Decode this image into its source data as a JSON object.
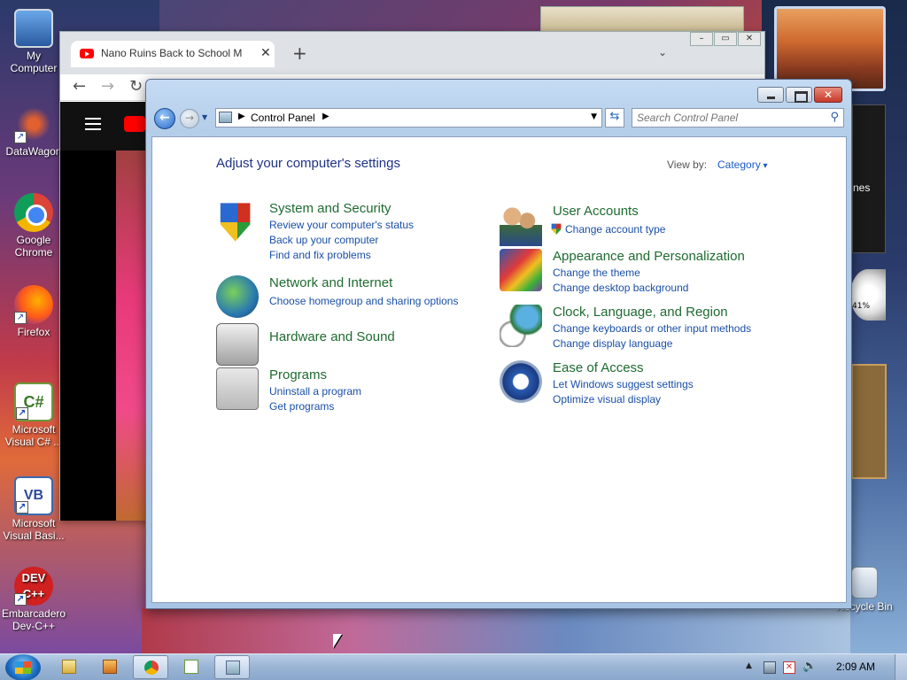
{
  "desktop": {
    "icons": [
      {
        "label": "My Computer",
        "icon": "computer-icon"
      },
      {
        "label": "DataWagon",
        "icon": "datawagon-icon"
      },
      {
        "label": "Google Chrome",
        "icon": "chrome-icon"
      },
      {
        "label": "Firefox",
        "icon": "firefox-icon"
      },
      {
        "label": "Microsoft Visual C# ...",
        "icon": "visual-csharp-icon"
      },
      {
        "label": "Microsoft Visual Basi...",
        "icon": "visual-basic-icon"
      },
      {
        "label": "Embarcadero Dev-C++",
        "icon": "devcpp-icon"
      },
      {
        "label": "Recycle Bin",
        "icon": "recycle-bin-icon"
      }
    ],
    "gadget_text": "nes",
    "gauge_text": "41%"
  },
  "browser": {
    "tab_title": "Nano Ruins Back to School M",
    "tab_close": "✕",
    "new_tab": "+",
    "tab_dropdown": "⌄"
  },
  "control_panel": {
    "breadcrumb": "Control Panel",
    "search_placeholder": "Search Control Panel",
    "heading": "Adjust your computer's settings",
    "view_by_label": "View by:",
    "view_by_value": "Category",
    "categories": [
      {
        "title": "System and Security",
        "icon": "shield-icon",
        "links": [
          "Review your computer's status",
          "Back up your computer",
          "Find and fix problems"
        ]
      },
      {
        "title": "Network and Internet",
        "icon": "network-icon",
        "links": [
          "Choose homegroup and sharing options"
        ]
      },
      {
        "title": "Hardware and Sound",
        "icon": "printer-icon",
        "links": []
      },
      {
        "title": "Programs",
        "icon": "programs-icon",
        "links": [
          "Uninstall a program",
          "Get programs"
        ]
      },
      {
        "title": "User Accounts",
        "icon": "users-icon",
        "links": [
          "Change account type"
        ]
      },
      {
        "title": "Appearance and Personalization",
        "icon": "appearance-icon",
        "links": [
          "Change the theme",
          "Change desktop background"
        ]
      },
      {
        "title": "Clock, Language, and Region",
        "icon": "clock-globe-icon",
        "links": [
          "Change keyboards or other input methods",
          "Change display language"
        ]
      },
      {
        "title": "Ease of Access",
        "icon": "ease-of-access-icon",
        "links": [
          "Let Windows suggest settings",
          "Optimize visual display"
        ]
      }
    ]
  },
  "taskbar": {
    "clock": "2:09 AM",
    "buttons": [
      "folder-icon",
      "media-player-icon",
      "chrome-icon",
      "visual-csharp-icon",
      "control-panel-icon"
    ]
  },
  "colors": {
    "category_title": "#1e6b30",
    "link": "#1a4fa8",
    "heading": "#1e3287"
  }
}
